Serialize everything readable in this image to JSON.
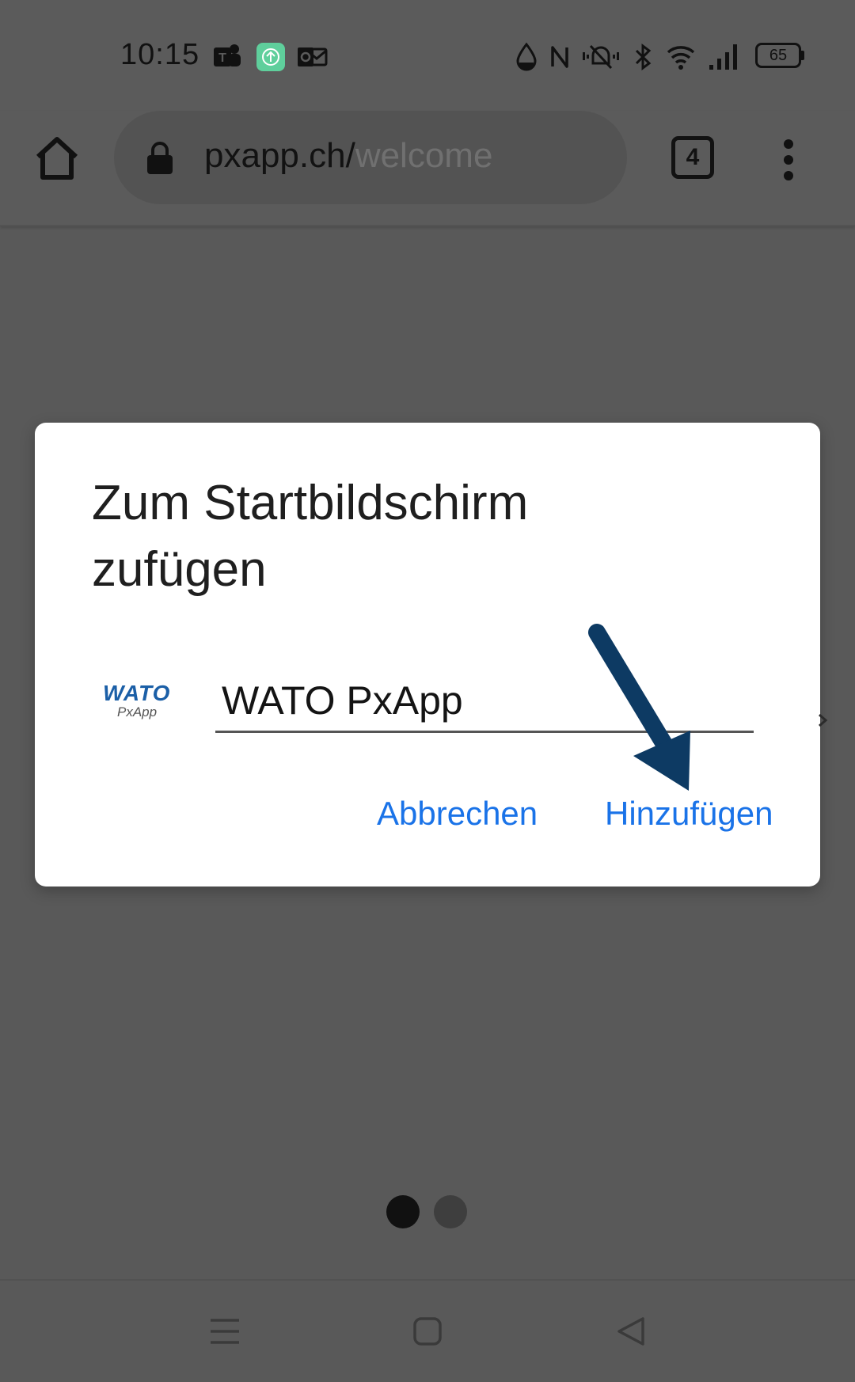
{
  "status_bar": {
    "time": "10:15",
    "battery_level": "65",
    "app_icons": [
      "teams-icon",
      "upload-icon",
      "outlook-icon"
    ],
    "system_icons": [
      "drop-icon",
      "nfc-icon",
      "vibrate-off-icon",
      "bluetooth-icon",
      "wifi-icon",
      "signal-icon",
      "battery-icon"
    ]
  },
  "browser": {
    "url_host": "pxapp.ch/",
    "url_path": "welcome",
    "tab_count": "4"
  },
  "dialog": {
    "title": "Zum Startbildschirm zufügen",
    "logo_top": "WATO",
    "logo_bottom": "PxApp",
    "app_name_value": "WATO PxApp",
    "cancel_label": "Abbrechen",
    "add_label": "Hinzufügen"
  },
  "colors": {
    "accent_blue": "#1a73e8",
    "annotation_arrow": "#0d3a63",
    "scrim": "#595959",
    "logo_blue": "#1b5fa7",
    "battery_badge": "#5fcf9c"
  },
  "pager": {
    "page_count": 2,
    "active_index": 0
  },
  "nav": {
    "buttons": [
      "recents-icon",
      "home-nav-icon",
      "back-icon"
    ]
  }
}
